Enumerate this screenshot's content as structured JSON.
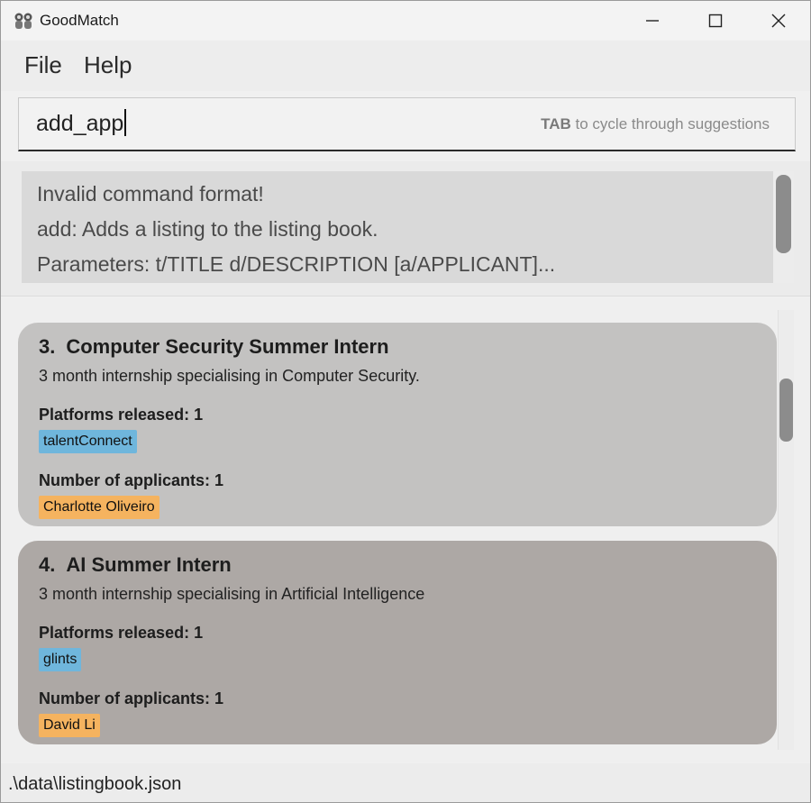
{
  "window": {
    "title": "GoodMatch",
    "icon": "app-people-icon"
  },
  "menu": {
    "items": [
      {
        "label": "File"
      },
      {
        "label": "Help"
      }
    ]
  },
  "command": {
    "value": "add_app",
    "hint_key": "TAB",
    "hint_text": " to cycle through suggestions"
  },
  "result": {
    "lines": [
      "Invalid command format!",
      "add: Adds a listing to the listing book.",
      "Parameters: t/TITLE d/DESCRIPTION [a/APPLICANT]..."
    ]
  },
  "listings": [
    {
      "index": "3.",
      "title": "Computer Security Summer Intern",
      "description": "3 month internship specialising in Computer Security.",
      "platforms_label": "Platforms released: 1",
      "platforms": [
        "talentConnect"
      ],
      "applicants_label": "Number of applicants: 1",
      "applicants": [
        "Charlotte Oliveiro"
      ]
    },
    {
      "index": "4.",
      "title": "AI Summer Intern",
      "description": "3 month internship specialising in Artificial Intelligence",
      "platforms_label": "Platforms released: 1",
      "platforms": [
        "glints"
      ],
      "applicants_label": "Number of applicants: 1",
      "applicants": [
        "David Li"
      ]
    }
  ],
  "status": {
    "file_path": ".\\data\\listingbook.json"
  },
  "colors": {
    "card_odd": "#c3c2c1",
    "card_even": "#ada8a5",
    "platform_tag": "#6fb6dc",
    "applicant_tag": "#f5b35f"
  }
}
